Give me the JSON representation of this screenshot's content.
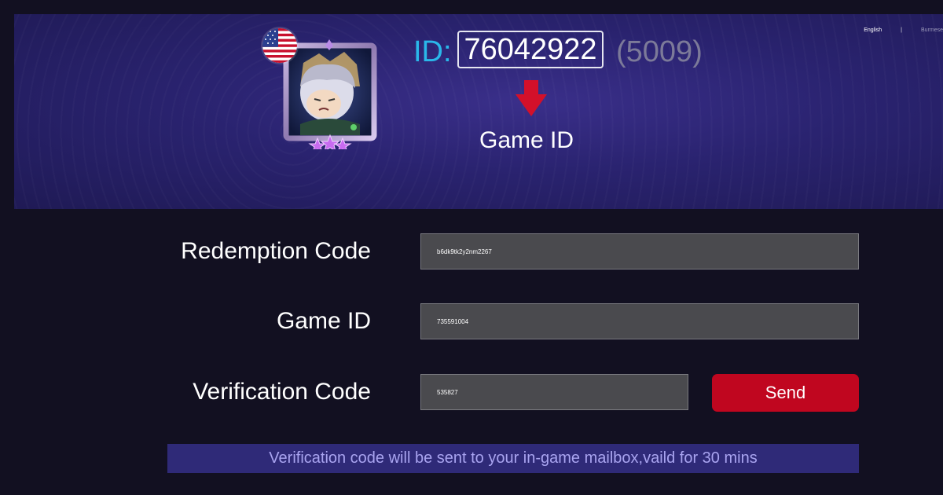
{
  "languages": {
    "current": "English",
    "separator": "|",
    "other": "Burmese"
  },
  "banner": {
    "id_prefix": "ID:",
    "game_id_value": "76042922",
    "server_id": "(5009)",
    "game_id_caption": "Game ID",
    "flag_icon": "us-flag-icon",
    "avatar_icon": "hero-avatar-icon",
    "arrow_icon": "red-arrow-down-icon"
  },
  "form": {
    "redemption_code": {
      "label": "Redemption Code",
      "value": "b6dk9tk2y2nm2267"
    },
    "game_id": {
      "label": "Game ID",
      "value": "735591004"
    },
    "verification_code": {
      "label": "Verification Code",
      "value": "535827"
    },
    "send_label": "Send"
  },
  "notice": "Verification code will be sent to your in-game mailbox,vaild for 30 mins",
  "colors": {
    "background": "#121021",
    "banner": "#2a2370",
    "accent_blue": "#2ab8ea",
    "send_red": "#c0061f",
    "notice_bg": "#2f2a78"
  }
}
